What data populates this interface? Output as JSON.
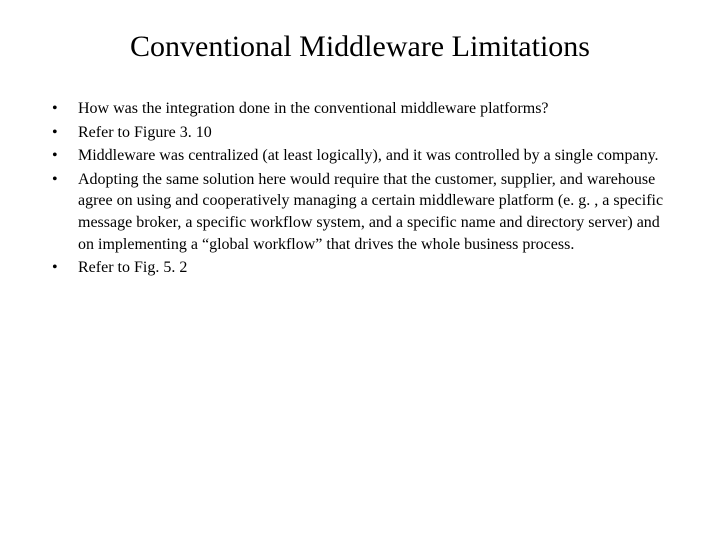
{
  "title": "Conventional Middleware Limitations",
  "bullets": [
    "How was the integration done in the conventional middleware platforms?",
    "Refer to Figure 3. 10",
    "Middleware was centralized (at least logically), and it was controlled by a single company.",
    "Adopting the same solution here would require that the customer, supplier, and warehouse agree on using and cooperatively managing a certain middleware platform (e. g. , a specific message broker, a specific workflow system, and a specific name and directory server) and on implementing a “global workflow” that drives the whole business process.",
    "Refer to Fig. 5. 2"
  ]
}
